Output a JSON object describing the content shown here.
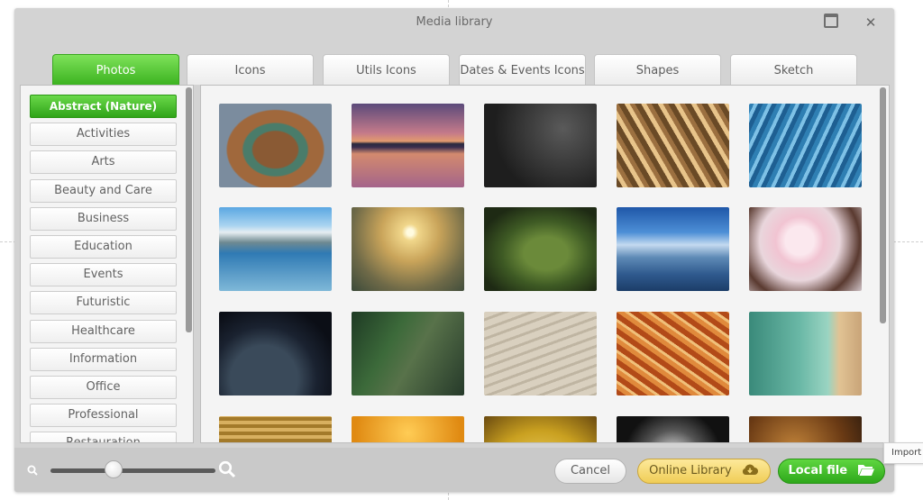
{
  "dialog": {
    "title": "Media library"
  },
  "tabs": [
    "Photos",
    "Icons",
    "Utils Icons",
    "Dates & Events Icons",
    "Shapes",
    "Sketch"
  ],
  "categories": [
    "Abstract (Nature)",
    "Activities",
    "Arts",
    "Beauty and Care",
    "Business",
    "Education",
    "Events",
    "Futuristic",
    "Healthcare",
    "Information",
    "Office",
    "Professional",
    "Restauration"
  ],
  "active_category": "Abstract (Nature)",
  "thumbnails": [
    "horseshoe-bend",
    "lake-sunset-reflection",
    "dark-rain-leaves",
    "golden-bokeh-streaks",
    "blue-ice-crystals",
    "mountain-lake",
    "misty-sunrise-field",
    "leaf-water-drops",
    "blue-mountain-ridges",
    "cherry-blossoms",
    "earth-night-lights",
    "green-canyon-cliff",
    "sand-dune-ripples",
    "sandstone-waves",
    "turquoise-coast",
    "wheat-field",
    "orange-glow",
    "yellow-sunset",
    "dew-drops-macro",
    "amber-stones"
  ],
  "footer": {
    "cancel_label": "Cancel",
    "online_label": "Online Library",
    "local_label": "Local file",
    "tooltip": "Import"
  },
  "zoom": {
    "level": 0.38
  },
  "colors": {
    "accent_green": "#3cb320",
    "online_yellow": "#f0cd57",
    "dialog_bg": "#d3d3d3"
  }
}
